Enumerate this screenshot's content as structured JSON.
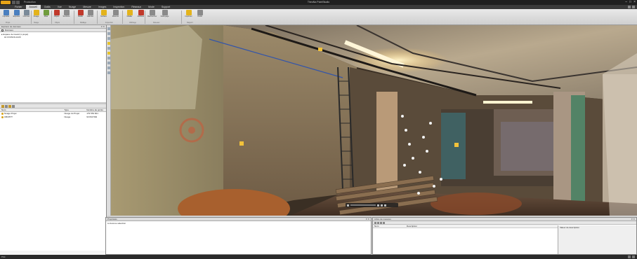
{
  "window": {
    "title": "TheoNa PointStudio",
    "qat_label": "Production"
  },
  "tabs": [
    {
      "label": "Fichier"
    },
    {
      "label": "Accueil"
    },
    {
      "label": "Outils"
    },
    {
      "label": "Vue"
    },
    {
      "label": "Nuage"
    },
    {
      "label": "Mesure"
    },
    {
      "label": "Images"
    },
    {
      "label": "Inspection"
    },
    {
      "label": "Réseaux"
    },
    {
      "label": "Mode"
    },
    {
      "label": "Support"
    }
  ],
  "ribbon": {
    "buttons": [
      {
        "label": "Importer",
        "color": "#4a7fbf"
      },
      {
        "label": "Exporter",
        "color": "#4a7fbf"
      },
      {
        "label": "Informer",
        "color": "#7a8a99"
      },
      {
        "label": "Nuage",
        "color": "#e3b31c"
      },
      {
        "label": "Mise",
        "color": "#6f9c3d"
      },
      {
        "label": "Objets",
        "color": "#c0392b"
      },
      {
        "label": "Sections",
        "color": "#8a8a8a"
      },
      {
        "label": "Maille",
        "color": "#c0392b"
      },
      {
        "label": "Calculer",
        "color": "#8a8a8a"
      },
      {
        "label": "Surface",
        "color": "#e3b31c"
      },
      {
        "label": "Mesurer",
        "color": "#8a8a8a"
      },
      {
        "label": "Mailler",
        "color": "#e3b31c"
      },
      {
        "label": "Attribuer",
        "color": "#c0392b"
      },
      {
        "label": "Rechercher",
        "color": "#8a8a8a"
      },
      {
        "label": "Nettoyage",
        "color": "#8a8a8a"
      },
      {
        "label": "Imprimer",
        "color": "#e3b31c"
      },
      {
        "label": "Outils",
        "color": "#8a8a8a"
      }
    ],
    "groups": [
      "Projet",
      "Nuage",
      "Objets",
      "Maillage",
      "Inspection",
      "Affichage",
      "Réseaux",
      "Rapport"
    ]
  },
  "left_panel": {
    "header": "Explorer de données",
    "toolbar_label": "Données",
    "tree": [
      {
        "label": "Espace de travail (1 projet)"
      },
      {
        "label": "COUNCIL1220"
      }
    ],
    "grid_headers": [
      "Nom",
      "Type",
      "Nombre de points"
    ],
    "grid_rows": [
      [
        "Nuage Projet",
        "Nuage du Projet",
        "179 553 601"
      ],
      [
        "CBCBTT",
        "Nuage",
        "93 840 592"
      ]
    ]
  },
  "properties": {
    "header": "Propriétés",
    "body": "Aucune sélection"
  },
  "measures": {
    "header": "Arbre de mesures",
    "columns": [
      "Nom",
      "Description"
    ],
    "desc_label": "Valeur de description"
  },
  "status": {
    "text": "Prêt"
  }
}
